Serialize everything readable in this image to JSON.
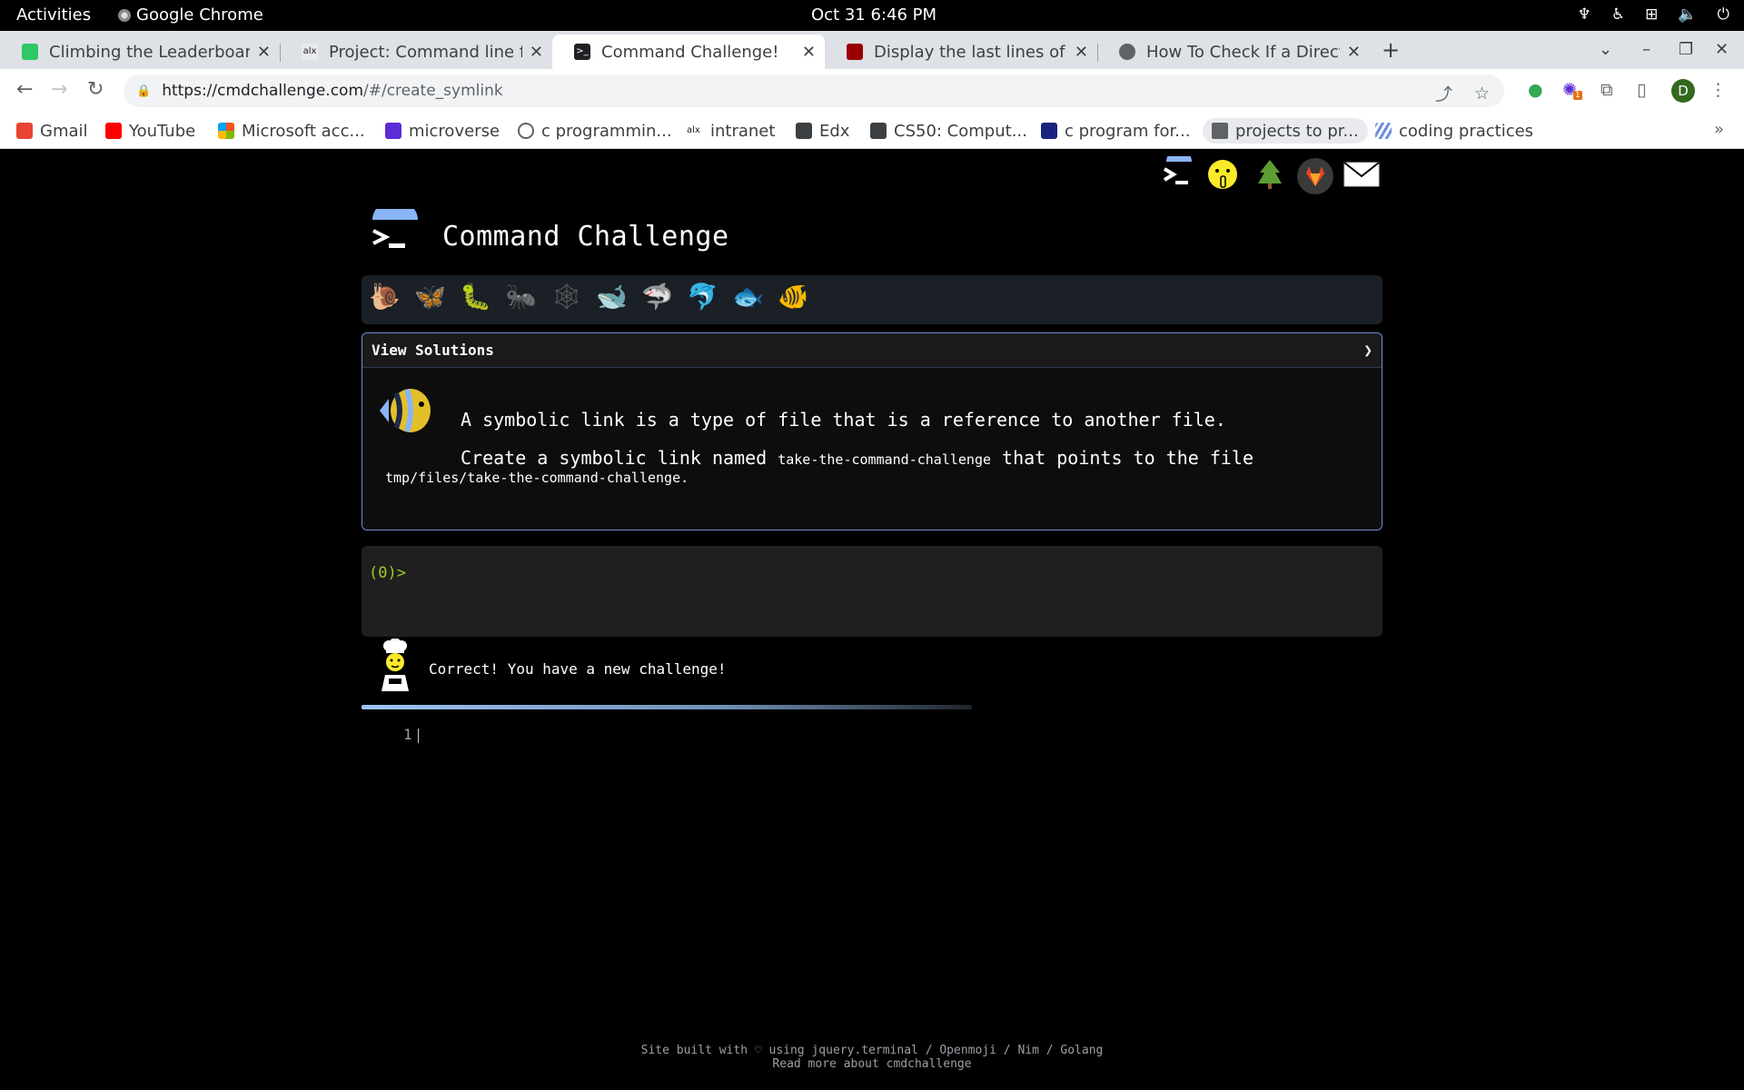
{
  "os": {
    "activities": "Activities",
    "app_name": "Google Chrome",
    "clock": "Oct 31   6:46 PM"
  },
  "tabs": [
    {
      "title": "Climbing the Leaderboard",
      "favicon_color": "#2ec866",
      "active": false
    },
    {
      "title": "Project: Command line for",
      "favicon_color": "#9aa0a6",
      "active": false
    },
    {
      "title": "Command Challenge!",
      "favicon_color": "#202124",
      "active": true
    },
    {
      "title": "Display the last lines of a f",
      "favicon_color": "#990000",
      "active": false
    },
    {
      "title": "How To Check If a Directo",
      "favicon_color": "#5f6368",
      "active": false
    }
  ],
  "toolbar": {
    "url_host": "https://cmdchallenge.com",
    "url_path": "/#/create_symlink",
    "profile_initial": "D",
    "extension_badge": "1"
  },
  "bookmarks": [
    {
      "label": "Gmail",
      "color": "#ea4335"
    },
    {
      "label": "YouTube",
      "color": "#ff0000"
    },
    {
      "label": "Microsoft acc...",
      "color": "#f25022"
    },
    {
      "label": "microverse",
      "color": "#5b2bd6"
    },
    {
      "label": "c programmin...",
      "color": "#5f6368"
    },
    {
      "label": "intranet",
      "color": "#202124"
    },
    {
      "label": "Edx",
      "color": "#3c4043"
    },
    {
      "label": "CS50: Comput...",
      "color": "#3c4043"
    },
    {
      "label": "c program for...",
      "color": "#1a237e"
    },
    {
      "label": "projects to pr...",
      "color": "#5f6368"
    },
    {
      "label": "coding practices",
      "color": "#6d8ed9"
    }
  ],
  "site": {
    "title": "Command Challenge",
    "view_solutions": "View Solutions",
    "chevron": "❯",
    "desc_line1": "A symbolic link is a type of file that is a reference to another file.",
    "desc_line2_pre": "Create a symbolic link named ",
    "desc_line2_code": "take-the-command-challenge",
    "desc_line2_post": " that points to the file",
    "desc_line3_code": "tmp/files/take-the-command-challenge",
    "desc_line3_post": ".",
    "prompt": "(0)>",
    "result_message": "Correct! You have a new challenge!",
    "editor_line_number": "1",
    "progress_fraction": 0.6,
    "footer_line1": "Site built with ♡ using jquery.terminal / Openmoji / Nim / Golang",
    "footer_line2": "Read more about cmdchallenge"
  },
  "level_icons": [
    "snail-icon",
    "butterfly-icon",
    "caterpillar-icon",
    "ant-icon",
    "spider-web-icon",
    "whale-icon",
    "shark-icon",
    "dolphin-icon",
    "fish-icon",
    "tropical-fish-icon"
  ]
}
